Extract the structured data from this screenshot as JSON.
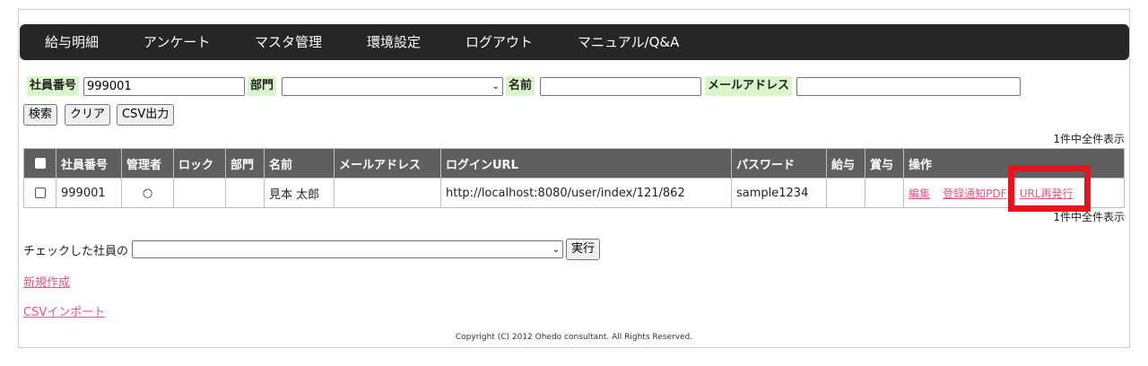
{
  "nav": {
    "items": [
      {
        "label": "給与明細"
      },
      {
        "label": "アンケート"
      },
      {
        "label": "マスタ管理"
      },
      {
        "label": "環境設定"
      },
      {
        "label": "ログアウト"
      },
      {
        "label": "マニュアル/Q&A"
      }
    ]
  },
  "search": {
    "employee_no_label": "社員番号",
    "employee_no_value": "999001",
    "department_label": "部門",
    "department_value": "",
    "name_label": "名前",
    "name_value": "",
    "email_label": "メールアドレス",
    "email_value": "",
    "search_button": "検索",
    "clear_button": "クリア",
    "csv_button": "CSV出力"
  },
  "result_count": "1件中全件表示",
  "table": {
    "headers": [
      "社員番号",
      "管理者",
      "ロック",
      "部門",
      "名前",
      "メールアドレス",
      "ログインURL",
      "パスワード",
      "給与",
      "賞与",
      "操作"
    ],
    "rows": [
      {
        "employee_no": "999001",
        "admin": "○",
        "lock": "",
        "department": "",
        "name": "見本 太郎",
        "email": "",
        "login_url": "http://localhost:8080/user/index/121/862",
        "password": "sample1234",
        "salary": "",
        "bonus": "",
        "actions": {
          "edit": "編集",
          "notify_pdf": "登録通知PDF",
          "reissue_url": "URL再発行"
        }
      }
    ]
  },
  "bulk": {
    "label": "チェックした社員の",
    "select_value": "",
    "execute_button": "実行"
  },
  "links": {
    "new": "新規作成",
    "csv_import": "CSVインポート"
  },
  "footer": {
    "copyright": "Copyright (C) 2012 Ohedo consultant. All Rights Reserved."
  },
  "colors": {
    "nav_bg": "#262626",
    "label_bg": "#d9f5cc",
    "table_header_bg": "#5f5f5f",
    "link": "#e4577f",
    "highlight": "#e8131b"
  }
}
